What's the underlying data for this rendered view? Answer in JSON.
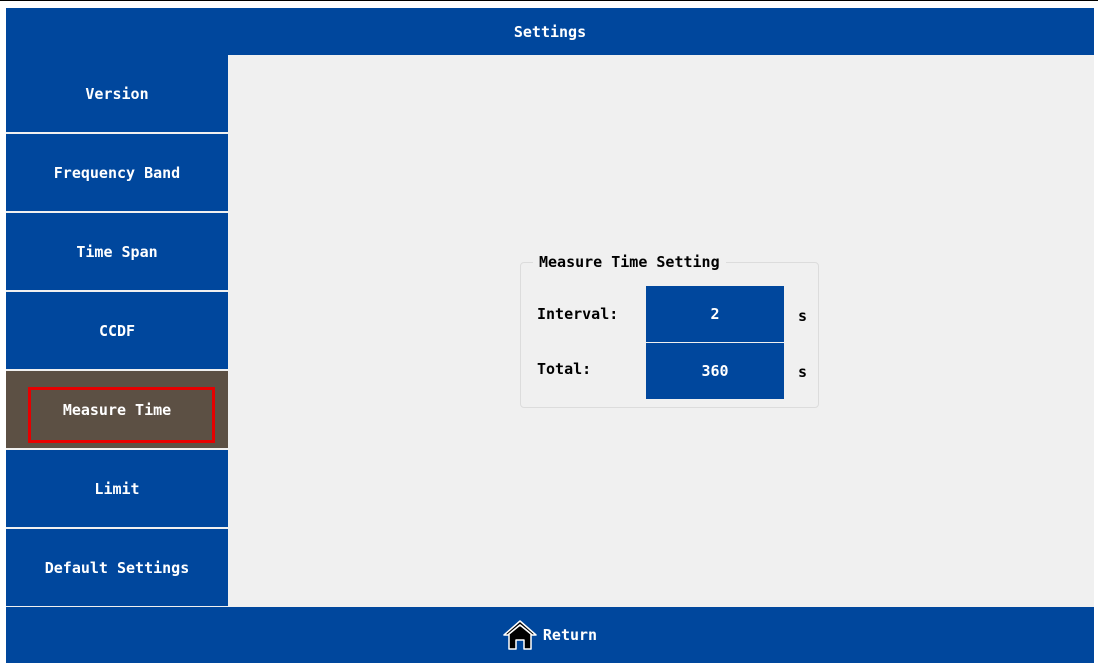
{
  "header": {
    "title": "Settings"
  },
  "sidebar": {
    "items": [
      {
        "label": "Version"
      },
      {
        "label": "Frequency Band"
      },
      {
        "label": "Time Span"
      },
      {
        "label": "CCDF"
      },
      {
        "label": "Measure Time",
        "active": true
      },
      {
        "label": "Limit"
      },
      {
        "label": "Default Settings"
      }
    ]
  },
  "measure_time": {
    "title": "Measure Time Setting",
    "interval": {
      "label": "Interval:",
      "value": "2",
      "unit": "s"
    },
    "total": {
      "label": "Total:",
      "value": "360",
      "unit": "s"
    }
  },
  "footer": {
    "return_label": "Return",
    "icon": "home-icon"
  },
  "colors": {
    "primary": "#00479d",
    "active_item": "#5c5044",
    "highlight_outline": "#e60000",
    "background": "#f0f0f0"
  }
}
